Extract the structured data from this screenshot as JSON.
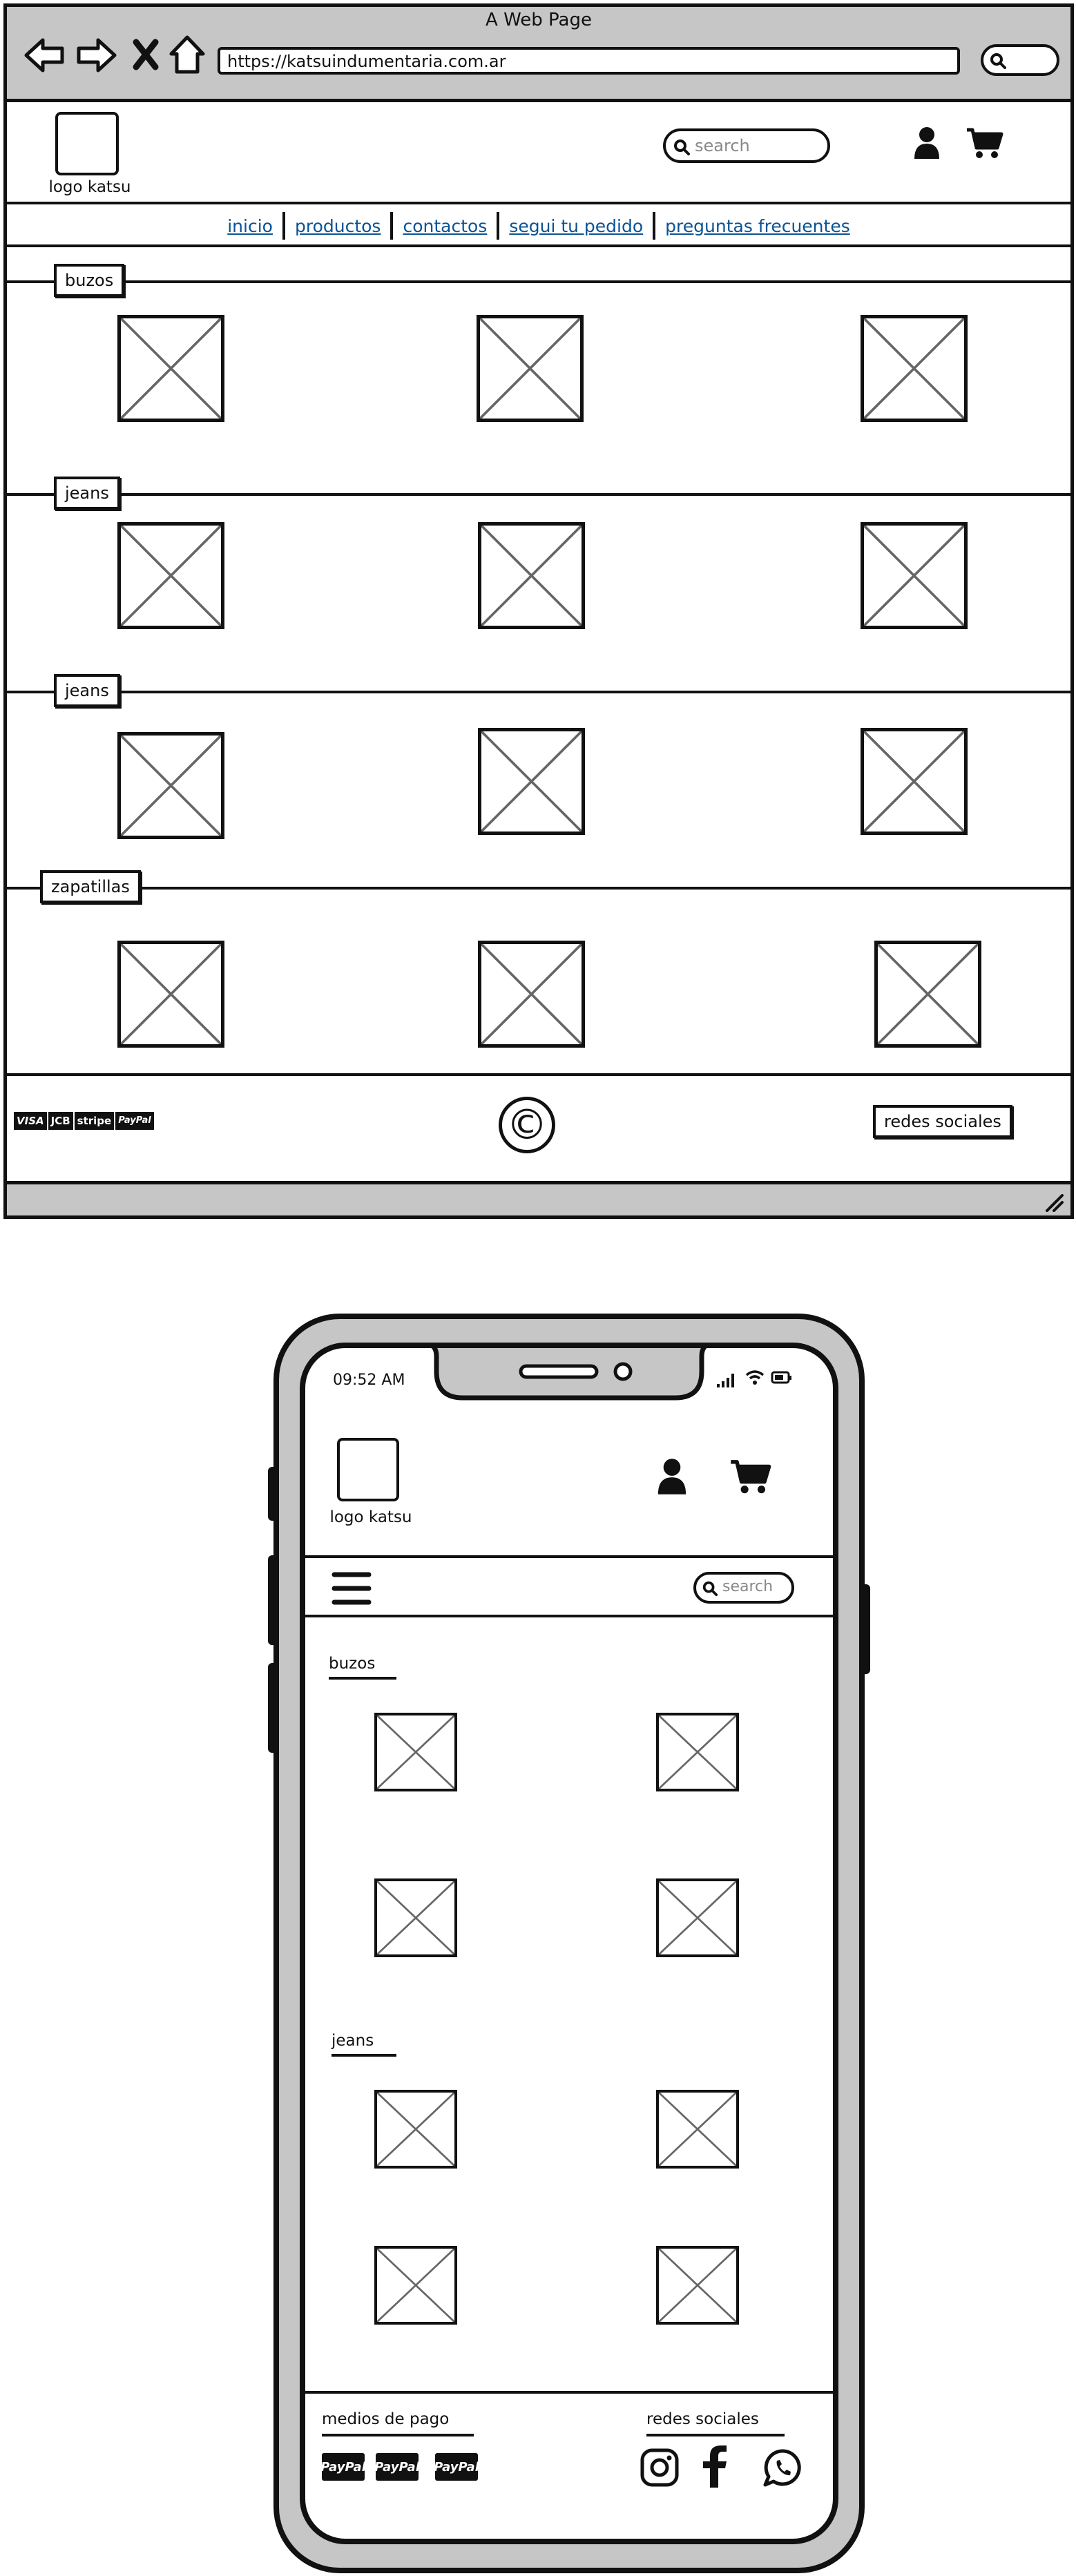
{
  "browser": {
    "window_title": "A Web Page",
    "url": "https://katsuindumentaria.com.ar"
  },
  "desktop": {
    "logo_label": "logo katsu",
    "search_placeholder": "search",
    "nav": [
      "inicio",
      "productos",
      "contactos",
      "segui tu pedido",
      "preguntas frecuentes"
    ],
    "categories": [
      "buzos",
      "jeans",
      "jeans",
      "zapatillas"
    ],
    "footer": {
      "payment_logos": [
        "VISA",
        "JCB",
        "stripe",
        "PayPal"
      ],
      "copyright_symbol": "©",
      "social_button": "redes sociales"
    }
  },
  "mobile": {
    "time": "09:52 AM",
    "logo_label": "logo katsu",
    "search_placeholder": "search",
    "categories": [
      "buzos",
      "jeans"
    ],
    "footer": {
      "payment_title": "medios de pago",
      "payment_logos": [
        "PayPal",
        "PayPal",
        "PayPal"
      ],
      "social_title": "redes sociales"
    }
  },
  "colors": {
    "chrome_gray": "#c6c6c6",
    "link_blue": "#0b5394",
    "ink": "#111111"
  }
}
